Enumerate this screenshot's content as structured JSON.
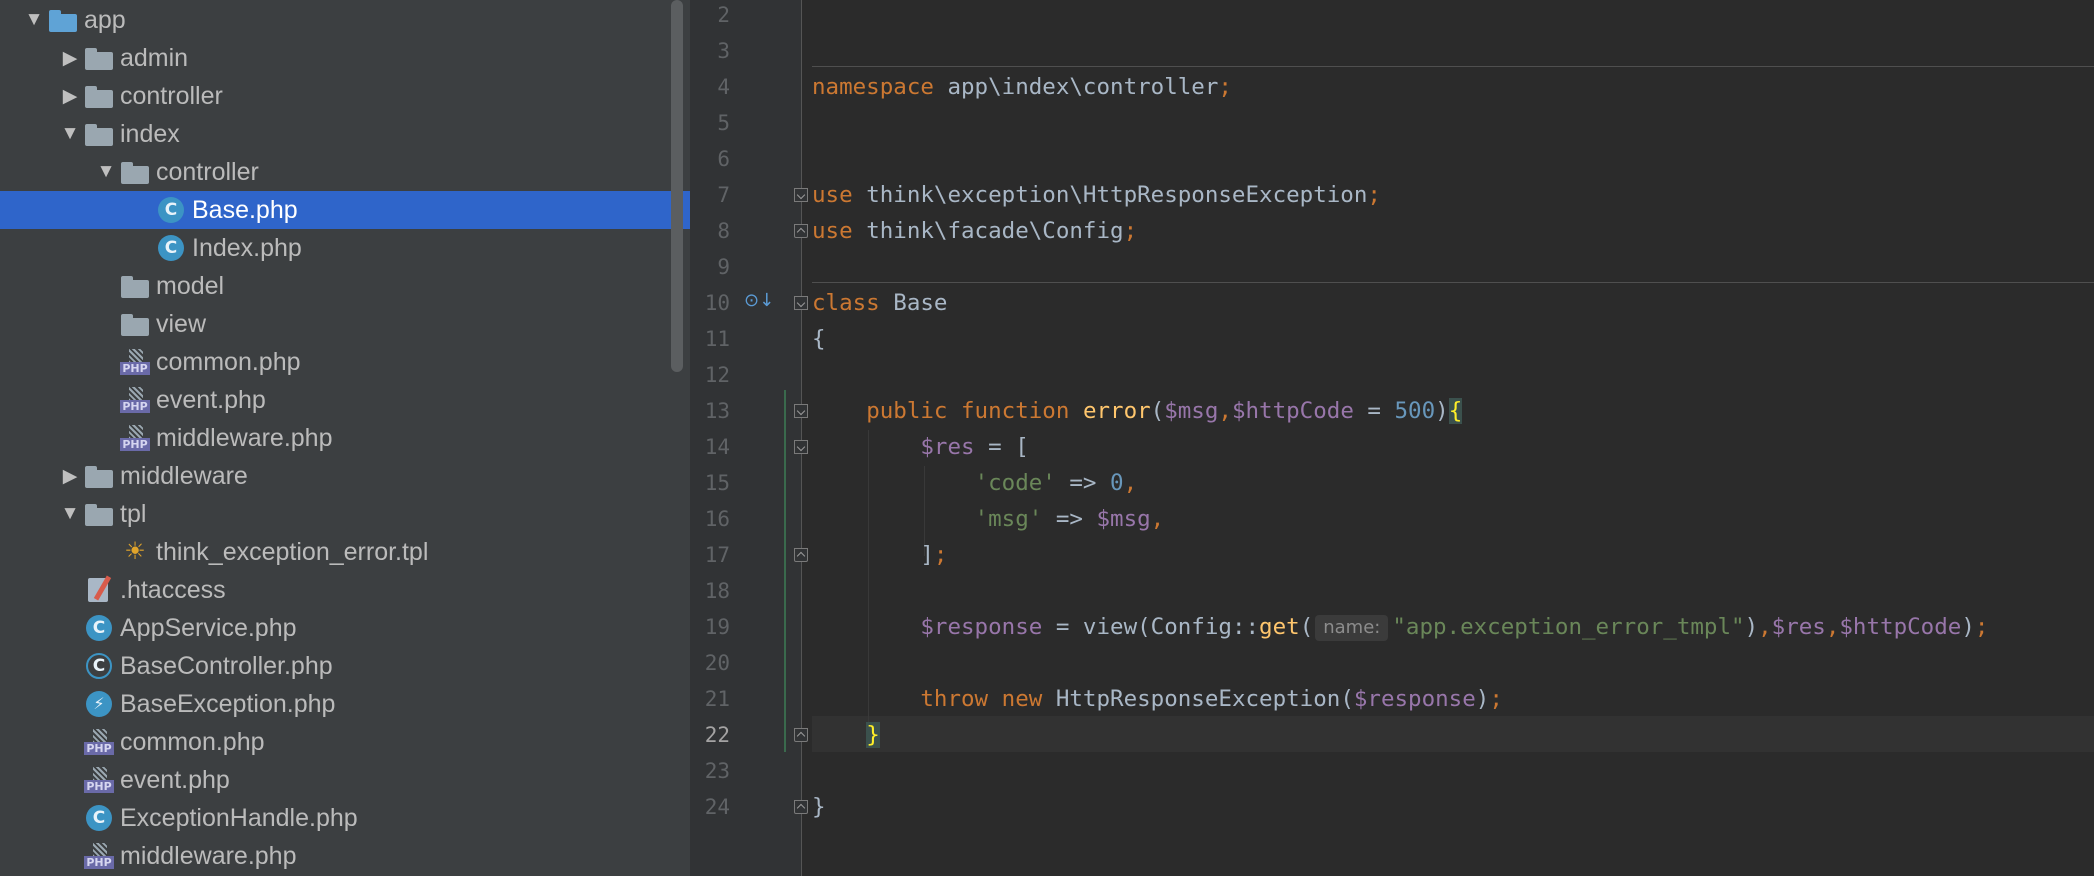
{
  "tree": [
    {
      "depth": 0,
      "type": "folder",
      "color": "blue",
      "expanded": true,
      "label": "app"
    },
    {
      "depth": 1,
      "type": "folder",
      "expanded": false,
      "label": "admin"
    },
    {
      "depth": 1,
      "type": "folder",
      "expanded": false,
      "label": "controller"
    },
    {
      "depth": 1,
      "type": "folder",
      "expanded": true,
      "label": "index"
    },
    {
      "depth": 2,
      "type": "folder",
      "expanded": true,
      "label": "controller"
    },
    {
      "depth": 3,
      "type": "class",
      "label": "Base.php",
      "selected": true
    },
    {
      "depth": 3,
      "type": "class",
      "label": "Index.php"
    },
    {
      "depth": 2,
      "type": "folder",
      "label": "model"
    },
    {
      "depth": 2,
      "type": "folder",
      "label": "view"
    },
    {
      "depth": 2,
      "type": "php",
      "label": "common.php"
    },
    {
      "depth": 2,
      "type": "php",
      "label": "event.php"
    },
    {
      "depth": 2,
      "type": "php",
      "label": "middleware.php"
    },
    {
      "depth": 1,
      "type": "folder",
      "expanded": false,
      "label": "middleware"
    },
    {
      "depth": 1,
      "type": "folder",
      "expanded": true,
      "label": "tpl"
    },
    {
      "depth": 2,
      "type": "tpl",
      "label": "think_exception_error.tpl"
    },
    {
      "depth": 1,
      "type": "htaccess",
      "label": ".htaccess"
    },
    {
      "depth": 1,
      "type": "class",
      "label": "AppService.php"
    },
    {
      "depth": 1,
      "type": "class-abstract",
      "label": "BaseController.php"
    },
    {
      "depth": 1,
      "type": "exception",
      "label": "BaseException.php"
    },
    {
      "depth": 1,
      "type": "php",
      "label": "common.php"
    },
    {
      "depth": 1,
      "type": "php",
      "label": "event.php"
    },
    {
      "depth": 1,
      "type": "class",
      "label": "ExceptionHandle.php"
    },
    {
      "depth": 1,
      "type": "php",
      "label": "middleware.php"
    }
  ],
  "icons": {
    "folder": "folder-icon",
    "class": "php-class-icon",
    "class-abstract": "php-abstract-class-icon",
    "exception": "php-exception-class-icon",
    "php": "php-file-icon",
    "tpl": "template-file-icon",
    "htaccess": "htaccess-file-icon",
    "expanded": "chevron-down-icon",
    "collapsed": "chevron-right-icon"
  },
  "editor": {
    "current_line": 22,
    "lines": [
      {
        "n": 2,
        "tokens": []
      },
      {
        "n": 3,
        "tokens": []
      },
      {
        "n": 4,
        "tokens": [
          {
            "t": "namespace ",
            "c": "kw"
          },
          {
            "t": "app\\index\\controller"
          },
          {
            "t": ";",
            "c": "kw"
          }
        ]
      },
      {
        "n": 5,
        "tokens": []
      },
      {
        "n": 6,
        "tokens": []
      },
      {
        "n": 7,
        "tokens": [
          {
            "t": "use ",
            "c": "kw"
          },
          {
            "t": "think\\exception\\HttpResponseException"
          },
          {
            "t": ";",
            "c": "kw"
          }
        ]
      },
      {
        "n": 8,
        "tokens": [
          {
            "t": "use ",
            "c": "kw"
          },
          {
            "t": "think\\facade\\Config"
          },
          {
            "t": ";",
            "c": "kw"
          }
        ]
      },
      {
        "n": 9,
        "tokens": []
      },
      {
        "n": 10,
        "tokens": [
          {
            "t": "class ",
            "c": "kw"
          },
          {
            "t": "Base"
          }
        ]
      },
      {
        "n": 11,
        "tokens": [
          {
            "t": "{"
          }
        ]
      },
      {
        "n": 12,
        "tokens": []
      },
      {
        "n": 13,
        "tokens": [
          {
            "t": "    "
          },
          {
            "t": "public ",
            "c": "kw"
          },
          {
            "t": "function ",
            "c": "kw"
          },
          {
            "t": "error",
            "c": "fn"
          },
          {
            "t": "("
          },
          {
            "t": "$msg",
            "c": "var"
          },
          {
            "t": ",",
            "c": "kw"
          },
          {
            "t": "$httpCode",
            "c": "var"
          },
          {
            "t": " = "
          },
          {
            "t": "500",
            "c": "num"
          },
          {
            "t": ")"
          },
          {
            "t": "{",
            "c": "br"
          }
        ]
      },
      {
        "n": 14,
        "tokens": [
          {
            "t": "        "
          },
          {
            "t": "$res",
            "c": "var"
          },
          {
            "t": " = ["
          }
        ]
      },
      {
        "n": 15,
        "tokens": [
          {
            "t": "            "
          },
          {
            "t": "'code'",
            "c": "str"
          },
          {
            "t": " => "
          },
          {
            "t": "0",
            "c": "num"
          },
          {
            "t": ",",
            "c": "kw"
          }
        ]
      },
      {
        "n": 16,
        "tokens": [
          {
            "t": "            "
          },
          {
            "t": "'msg'",
            "c": "str"
          },
          {
            "t": " => "
          },
          {
            "t": "$msg",
            "c": "var"
          },
          {
            "t": ",",
            "c": "kw"
          }
        ]
      },
      {
        "n": 17,
        "tokens": [
          {
            "t": "        "
          },
          {
            "t": "]"
          },
          {
            "t": ";",
            "c": "kw"
          }
        ]
      },
      {
        "n": 18,
        "tokens": []
      },
      {
        "n": 19,
        "tokens": [
          {
            "t": "        "
          },
          {
            "t": "$response",
            "c": "var"
          },
          {
            "t": " = view(Config::"
          },
          {
            "t": "get",
            "c": "fn"
          },
          {
            "t": "("
          },
          {
            "t": "name:",
            "c": "hint"
          },
          {
            "t": "\"app.exception_error_tmpl\"",
            "c": "str"
          },
          {
            "t": ")"
          },
          {
            "t": ",",
            "c": "kw"
          },
          {
            "t": "$res",
            "c": "var"
          },
          {
            "t": ",",
            "c": "kw"
          },
          {
            "t": "$httpCode",
            "c": "var"
          },
          {
            "t": ")"
          },
          {
            "t": ";",
            "c": "kw"
          }
        ]
      },
      {
        "n": 20,
        "tokens": []
      },
      {
        "n": 21,
        "tokens": [
          {
            "t": "        "
          },
          {
            "t": "throw ",
            "c": "kw"
          },
          {
            "t": "new ",
            "c": "kw"
          },
          {
            "t": "HttpResponseException("
          },
          {
            "t": "$response",
            "c": "var"
          },
          {
            "t": ")"
          },
          {
            "t": ";",
            "c": "kw"
          }
        ]
      },
      {
        "n": 22,
        "tokens": [
          {
            "t": "    "
          },
          {
            "t": "}",
            "c": "br"
          }
        ]
      },
      {
        "n": 23,
        "tokens": []
      },
      {
        "n": 24,
        "tokens": [
          {
            "t": "}"
          }
        ]
      }
    ],
    "folds": [
      {
        "line": 7,
        "kind": "open"
      },
      {
        "line": 8,
        "kind": "close"
      },
      {
        "line": 10,
        "kind": "open"
      },
      {
        "line": 13,
        "kind": "open"
      },
      {
        "line": 14,
        "kind": "open"
      },
      {
        "line": 17,
        "kind": "close"
      },
      {
        "line": 22,
        "kind": "close"
      },
      {
        "line": 24,
        "kind": "close"
      }
    ],
    "override_marker_icon": "implements-method-icon"
  },
  "colors": {
    "tree_bg": "#3c3f41",
    "selection": "#2f65ca",
    "editor_bg": "#2b2b2b",
    "keyword": "#cc7832",
    "function": "#ffc66d",
    "variable": "#9876aa",
    "number": "#6897bb",
    "string": "#6a8759"
  }
}
